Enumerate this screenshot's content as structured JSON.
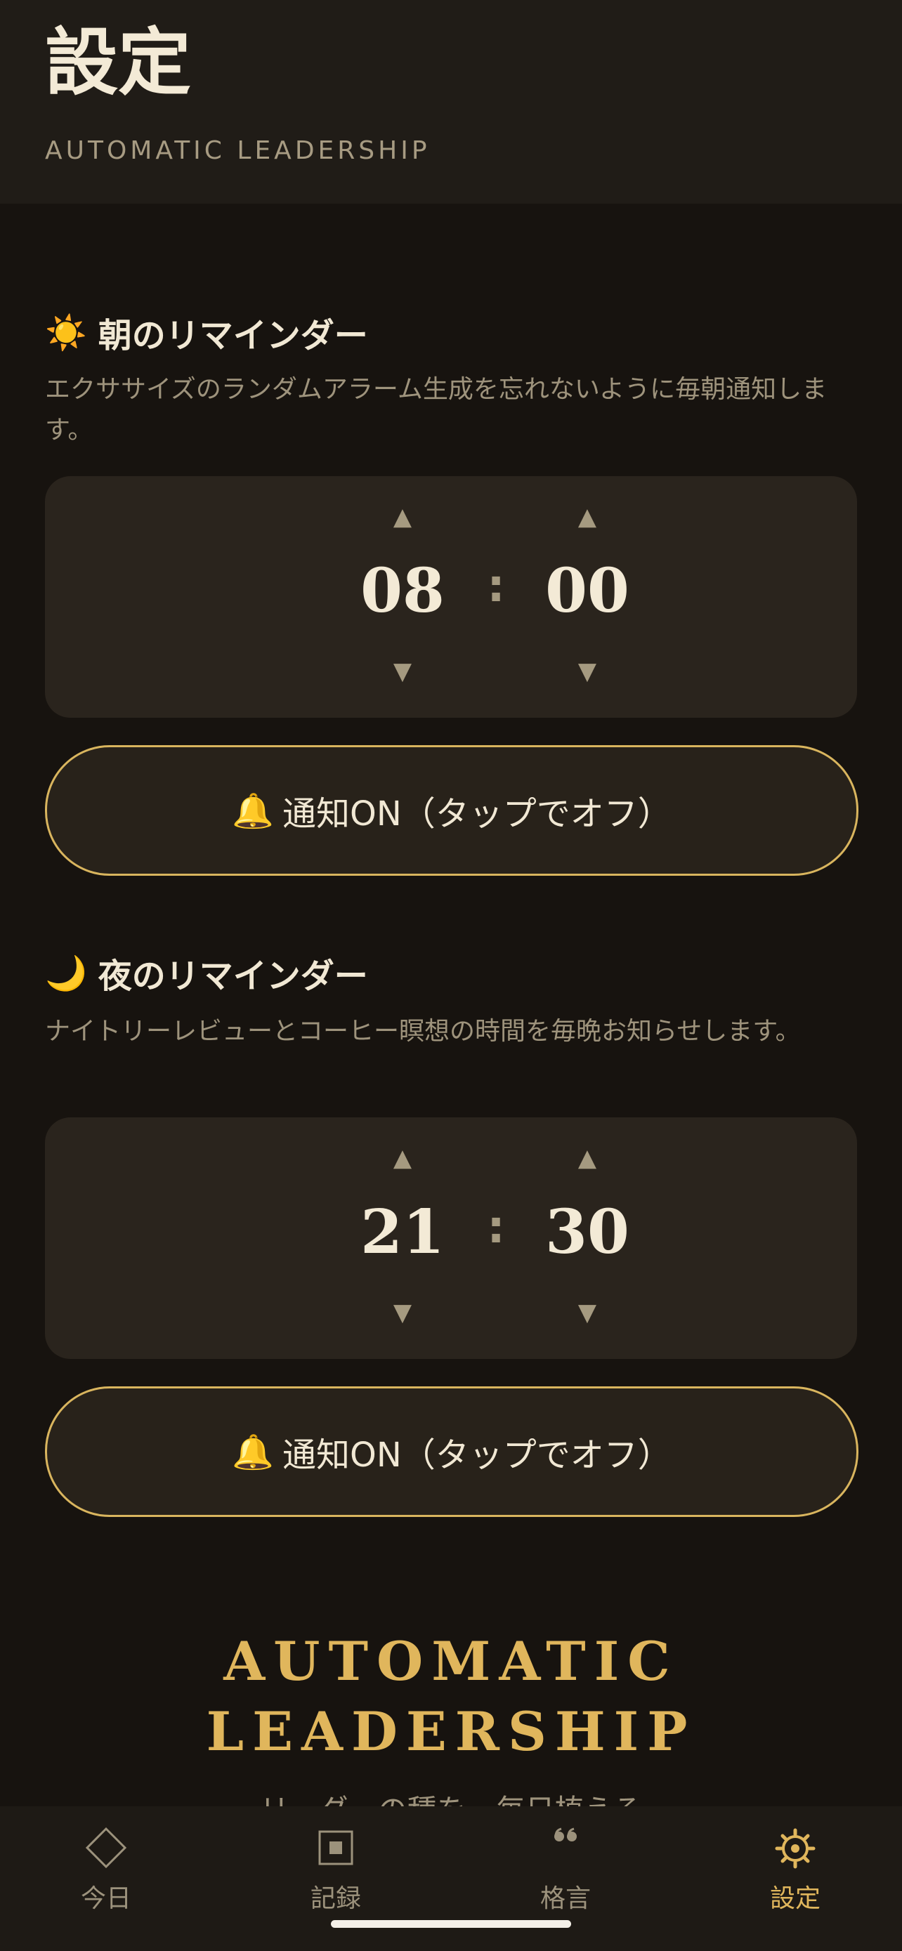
{
  "header": {
    "title": "設定",
    "subtitle": "AUTOMATIC LEADERSHIP"
  },
  "morning": {
    "emoji": "☀️",
    "title": "朝のリマインダー",
    "description": "エクササイズのランダムアラーム生成を忘れないように毎朝通知します。",
    "hour": "08",
    "minute": "00",
    "separator": ":",
    "up_arrow": "▲",
    "down_arrow": "▼",
    "toggle_emoji": "🔔",
    "toggle_label": "通知ON（タップでオフ）"
  },
  "evening": {
    "emoji": "🌙",
    "title": "夜のリマインダー",
    "description": "ナイトリーレビューとコーヒー瞑想の時間を毎晩お知らせします。",
    "hour": "21",
    "minute": "30",
    "separator": ":",
    "up_arrow": "▲",
    "down_arrow": "▼",
    "toggle_emoji": "🔔",
    "toggle_label": "通知ON（タップでオフ）"
  },
  "brand": {
    "line1": "AUTOMATIC",
    "line2": "LEADERSHIP",
    "tagline": "リーダーの種を、毎日植える"
  },
  "tabbar": {
    "active": "settings",
    "accent": "#e0b65c",
    "items": [
      {
        "label": "今日",
        "icon": "diamond-icon"
      },
      {
        "label": "記録",
        "icon": "square-record-icon"
      },
      {
        "label": "格言",
        "icon": "quote-icon"
      },
      {
        "label": "設定",
        "icon": "gear-icon"
      }
    ]
  }
}
